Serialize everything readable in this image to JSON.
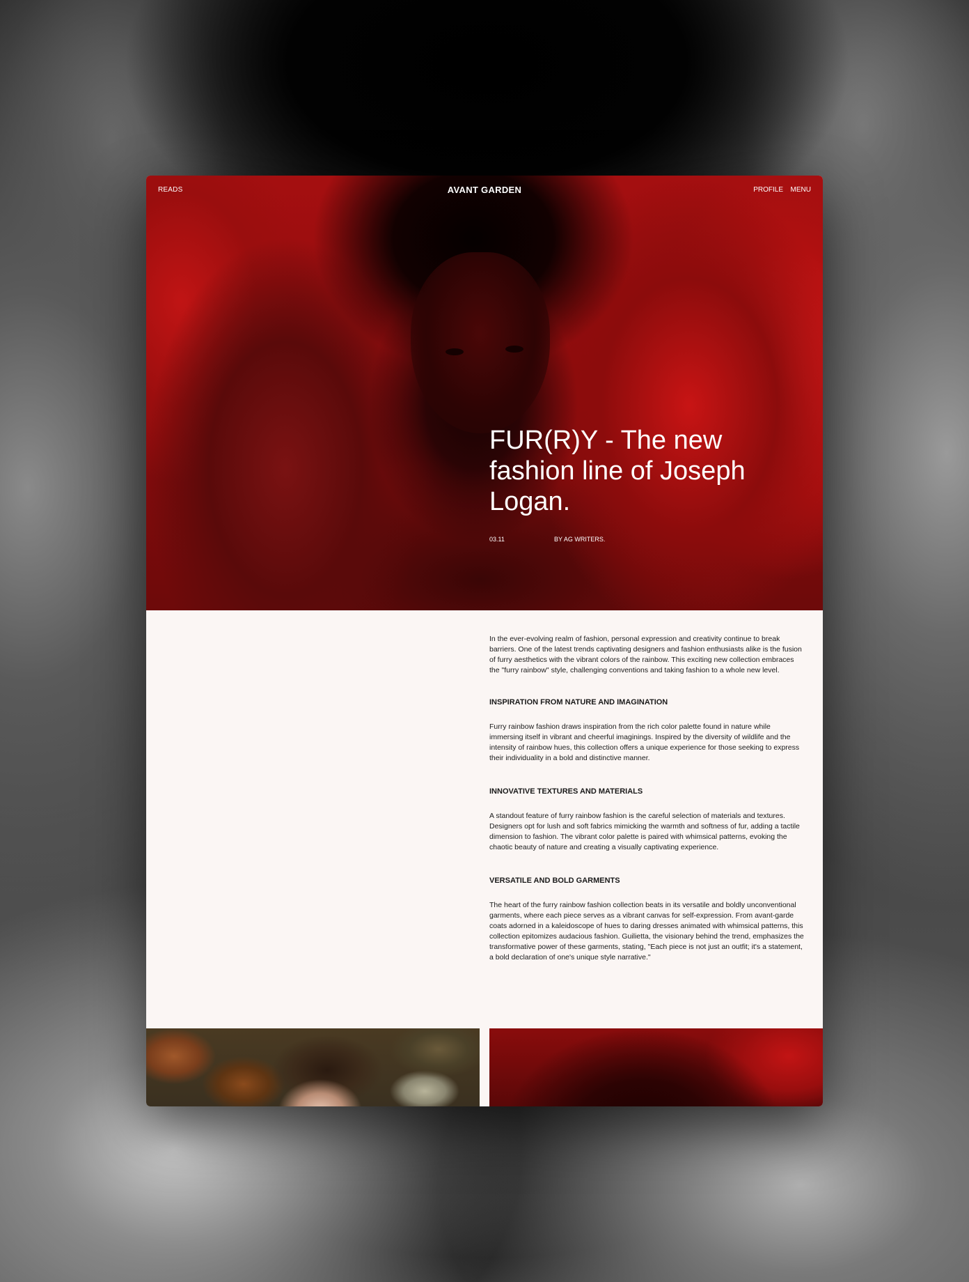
{
  "header": {
    "left_link": "READS",
    "brand": "AVANT GARDEN",
    "profile_link": "PROFILE",
    "menu_link": "MENU"
  },
  "hero": {
    "title": "FUR(R)Y - The new fashion line of Joseph Logan.",
    "date": "03.11",
    "author": "BY AG WRITERS."
  },
  "article": {
    "intro": "In the ever-evolving realm of fashion, personal expression and creativity continue to break barriers. One of the latest trends captivating designers and fashion enthusiasts alike is the fusion of furry aesthetics with the vibrant colors of the rainbow. This exciting new collection embraces the \"furry rainbow\" style, challenging conventions and taking fashion to a whole new level.",
    "sections": [
      {
        "heading": "INSPIRATION FROM NATURE AND IMAGINATION",
        "body": "Furry rainbow fashion draws inspiration from the rich color palette found in nature while immersing itself in vibrant and cheerful imaginings. Inspired by the diversity of wildlife and the intensity of rainbow hues, this collection offers a unique experience for those seeking to express their individuality in a bold and distinctive manner."
      },
      {
        "heading": "INNOVATIVE TEXTURES AND MATERIALS",
        "body": "A standout feature of furry rainbow fashion is the careful selection of materials and textures. Designers opt for lush and soft fabrics mimicking the warmth and softness of fur, adding a tactile dimension to fashion. The vibrant color palette is paired with whimsical patterns, evoking the chaotic beauty of nature and creating a visually captivating experience."
      },
      {
        "heading": "VERSATILE AND BOLD GARMENTS",
        "body": "The heart of the furry rainbow fashion collection beats in its versatile and boldly unconventional garments, where each piece serves as a vibrant canvas for self-expression. From avant-garde coats adorned in a kaleidoscope of hues to daring dresses animated with whimsical patterns, this collection epitomizes audacious fashion. Guilietta, the visionary behind the trend, emphasizes the transformative power of these garments, stating, \"Each piece is not just an outfit; it's a statement, a bold declaration of one's unique style narrative.\""
      }
    ]
  },
  "colors": {
    "hero_red": "#a50f10",
    "page_background": "#fbf6f4",
    "text": "#1a1a1a"
  }
}
